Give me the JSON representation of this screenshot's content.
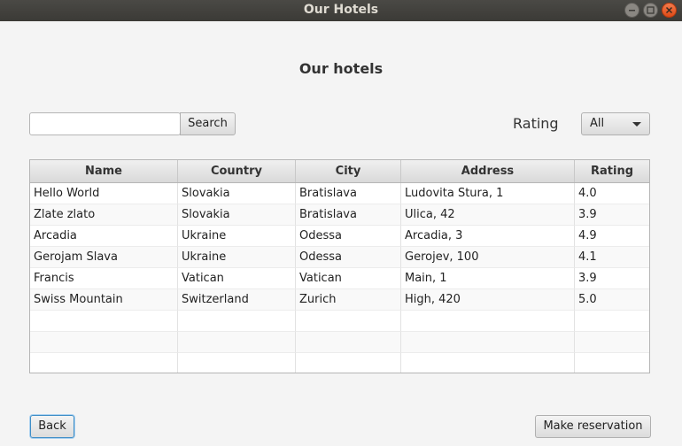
{
  "window": {
    "title": "Our Hotels"
  },
  "header": {
    "title": "Our hotels"
  },
  "search": {
    "value": "",
    "placeholder": "",
    "button_label": "Search"
  },
  "filter": {
    "label": "Rating",
    "selected": "All"
  },
  "table": {
    "columns": [
      "Name",
      "Country",
      "City",
      "Address",
      "Rating"
    ],
    "rows": [
      [
        "Hello World",
        "Slovakia",
        "Bratislava",
        "Ludovita Stura, 1",
        "4.0"
      ],
      [
        "Zlate zlato",
        "Slovakia",
        "Bratislava",
        "Ulica, 42",
        "3.9"
      ],
      [
        "Arcadia",
        "Ukraine",
        "Odessa",
        "Arcadia, 3",
        "4.9"
      ],
      [
        "Gerojam Slava",
        "Ukraine",
        "Odessa",
        "Gerojev, 100",
        "4.1"
      ],
      [
        "Francis",
        "Vatican",
        "Vatican",
        "Main, 1",
        "3.9"
      ],
      [
        "Swiss Mountain",
        "Switzerland",
        "Zurich",
        "High, 420",
        "5.0"
      ]
    ],
    "empty_rows": 3
  },
  "footer": {
    "back_label": "Back",
    "reserve_label": "Make reservation"
  }
}
